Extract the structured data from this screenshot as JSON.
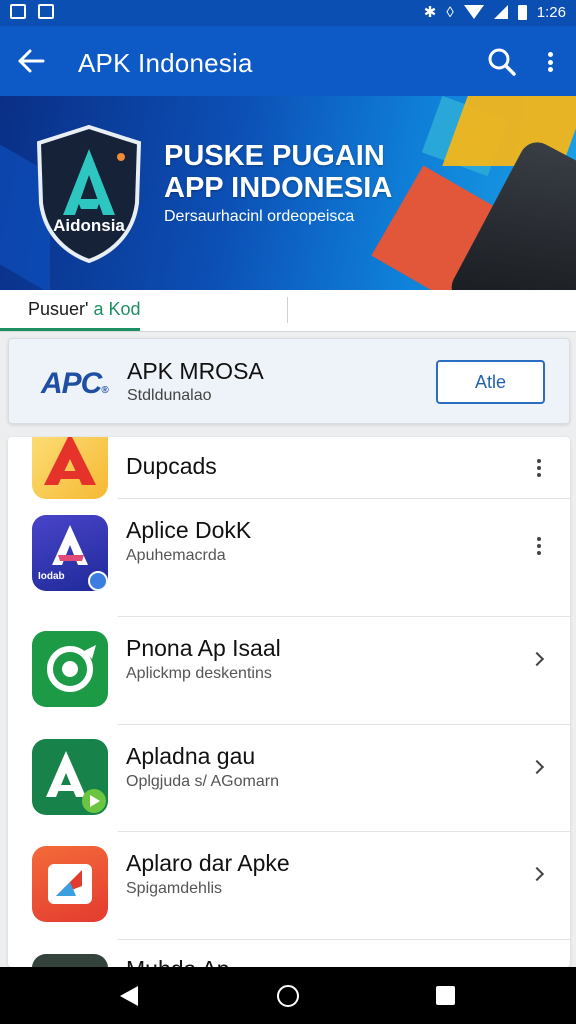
{
  "status_bar": {
    "time": "1:26"
  },
  "app_bar": {
    "title": "APK Indonesia"
  },
  "banner": {
    "shield_text": "Aidonsia",
    "title_line1": "PUSKE PUGAIN",
    "title_line2": "APP INDONESIA",
    "subtitle": "Dersaurhacinl ordeopeisca"
  },
  "tabs": {
    "active_label_a": "Pusuer'",
    "active_label_b": "a Kod"
  },
  "featured": {
    "logo": "APC",
    "name": "APK MROSA",
    "subtitle": "Stdldunalao",
    "button_label": "Atle"
  },
  "list": {
    "items": [
      {
        "label": "Dupcads",
        "sub": ""
      },
      {
        "label": "Aplice DokK",
        "sub": "Apuhemacrda",
        "icon_text": "Iodab"
      },
      {
        "label": "Pnona Ap Isaal",
        "sub": "Aplickmp deskentins"
      },
      {
        "label": "Apladna gau",
        "sub": "Oplgjuda s/ AGomarn"
      },
      {
        "label": "Aplaro dar Apke",
        "sub": "Spigamdehlis"
      },
      {
        "label": "Muhda Ap"
      }
    ]
  },
  "colors": {
    "status_bar": "#0b4fb3",
    "app_bar": "#0d59c6",
    "accent_green": "#1e8f62",
    "button_blue": "#2b6dc0"
  }
}
